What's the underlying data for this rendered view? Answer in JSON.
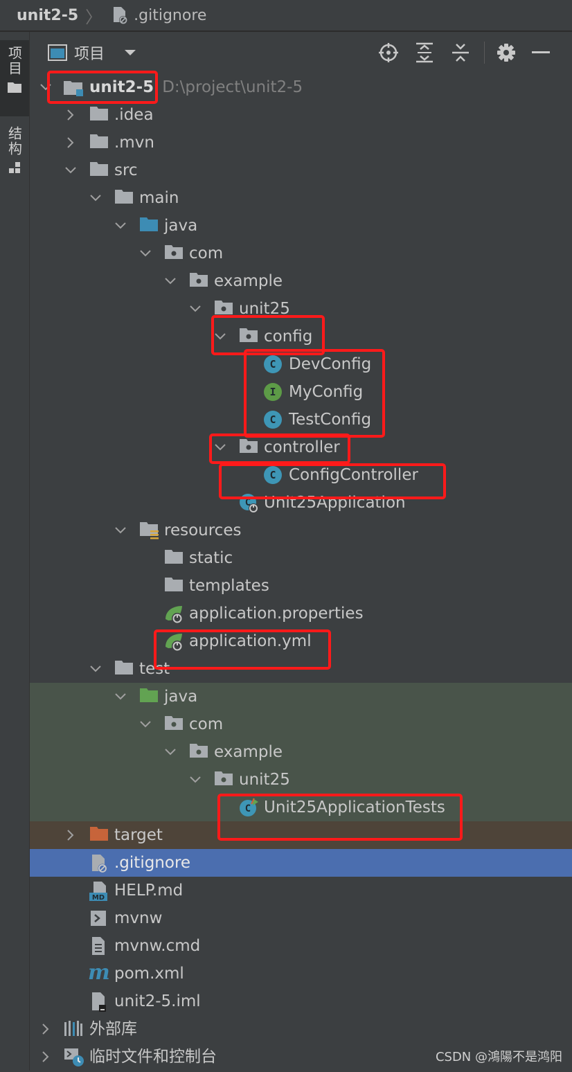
{
  "breadcrumb": {
    "project": "unit2-5",
    "file": ".gitignore"
  },
  "stripe": {
    "project_tab": "项目",
    "structure_tab": "结构"
  },
  "panel": {
    "title": "项目"
  },
  "tree": {
    "root": {
      "name": "unit2-5",
      "path": "D:\\project\\unit2-5"
    },
    "idea": ".idea",
    "mvn": ".mvn",
    "src": "src",
    "main": "main",
    "main_java": "java",
    "main_com": "com",
    "main_example": "example",
    "main_unit25": "unit25",
    "config": "config",
    "dev_config": "DevConfig",
    "my_config": "MyConfig",
    "test_config": "TestConfig",
    "controller": "controller",
    "config_controller": "ConfigController",
    "unit25_application": "Unit25Application",
    "resources": "resources",
    "static": "static",
    "templates": "templates",
    "app_properties": "application.properties",
    "app_yml": "application.yml",
    "test": "test",
    "test_java": "java",
    "test_com": "com",
    "test_example": "example",
    "test_unit25": "unit25",
    "unit25_tests": "Unit25ApplicationTests",
    "target": "target",
    "gitignore": ".gitignore",
    "help_md": "HELP.md",
    "mvnw": "mvnw",
    "mvnw_cmd": "mvnw.cmd",
    "pom": "pom.xml",
    "iml": "unit2-5.iml",
    "ext_libs": "外部库",
    "scratches": "临时文件和控制台"
  },
  "icons": {
    "class_letter": "C",
    "interface_letter": "I",
    "md_badge": "MD",
    "pom_letter": "m"
  },
  "colors": {
    "folder_gray": "#a9adb1",
    "source_blue": "#3d8cb4",
    "test_green": "#62a352",
    "excluded_orange": "#c7643a",
    "class_blue": "#3e96b6",
    "interface_green": "#5d9b47",
    "selection": "#4b6eaf",
    "highlight_red": "#ff1a1a"
  },
  "watermark": "CSDN @鴻陽不是鸿阳"
}
